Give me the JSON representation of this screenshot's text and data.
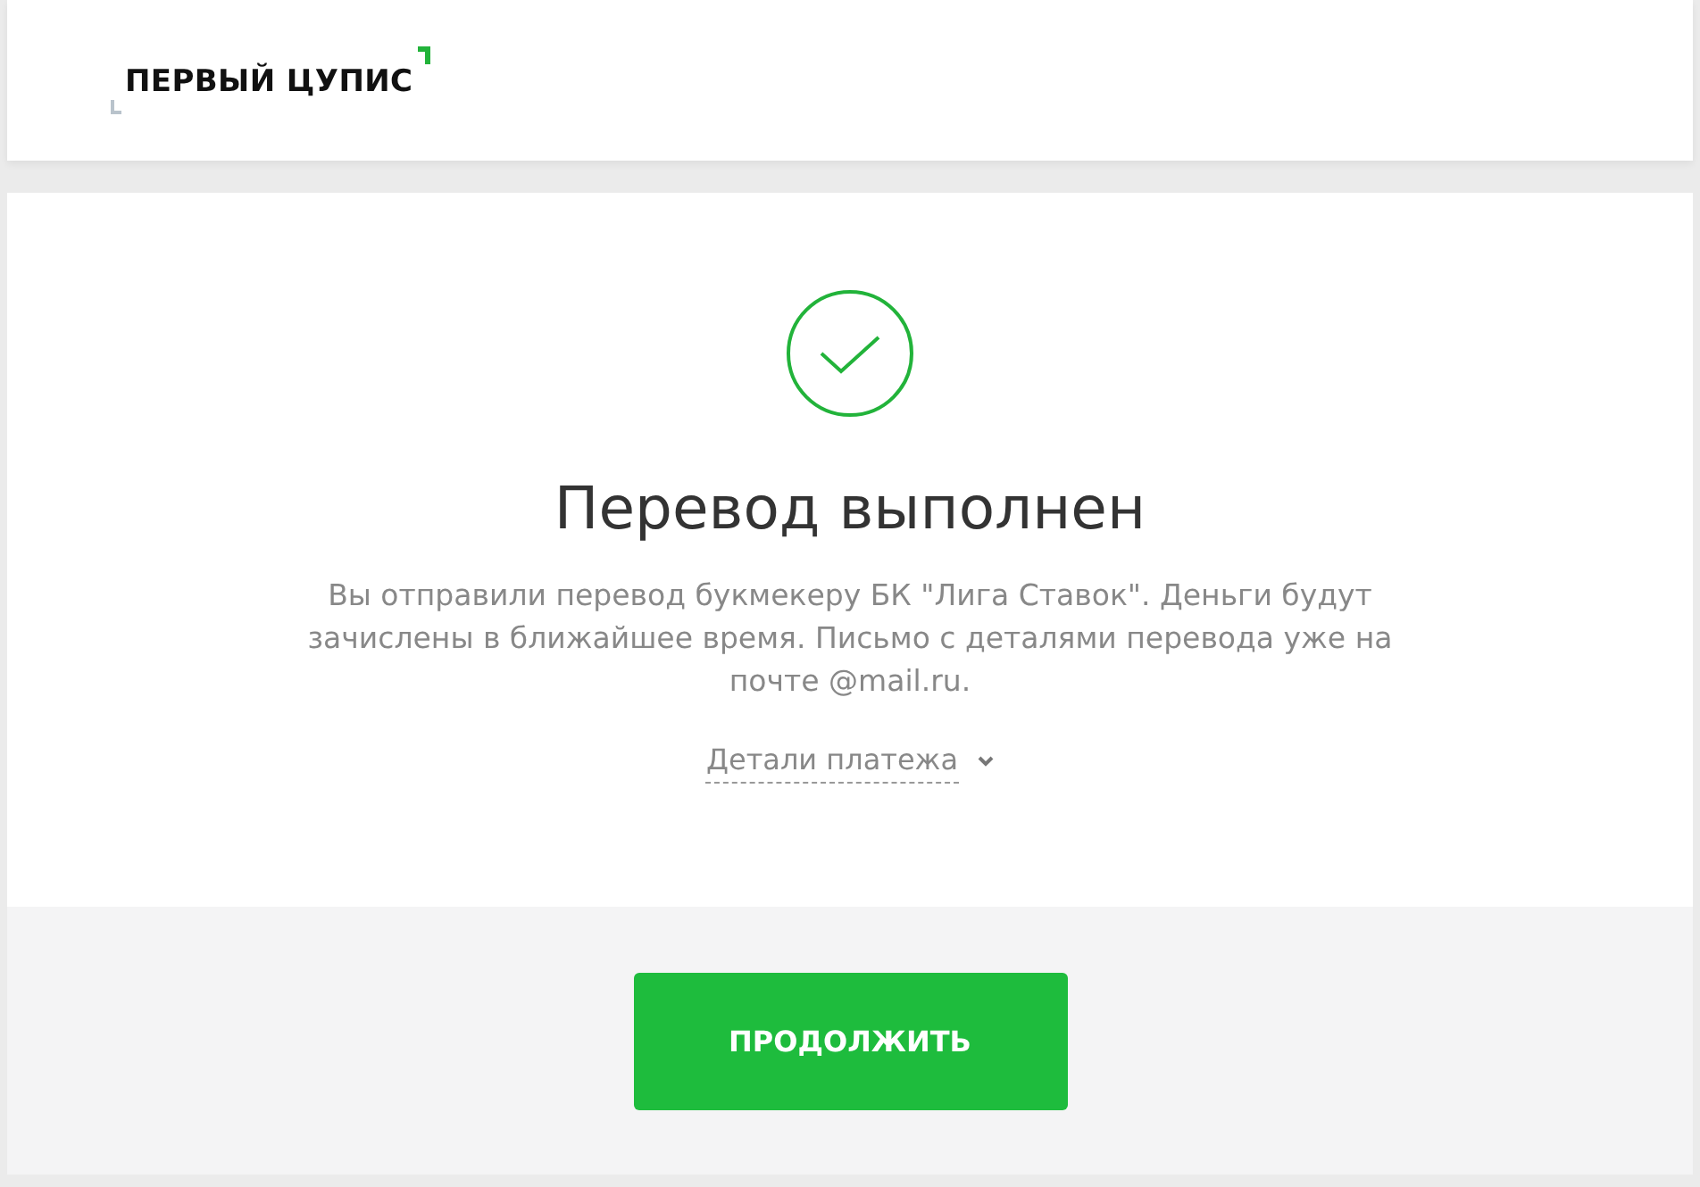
{
  "header": {
    "logo": "ПЕРВЫЙ ЦУПИС"
  },
  "result": {
    "success": true,
    "title": "Перевод выполнен",
    "message": "Вы отправили перевод букмекеру БК \"Лига Ставок\". Деньги будут зачислены в ближайшее время. Письмо с деталями перевода уже на почте @mail.ru.",
    "details_link": {
      "label": "Детали платежа",
      "expanded": false
    }
  },
  "buttons": [
    "ПРОДОЛЖИТЬ"
  ]
}
